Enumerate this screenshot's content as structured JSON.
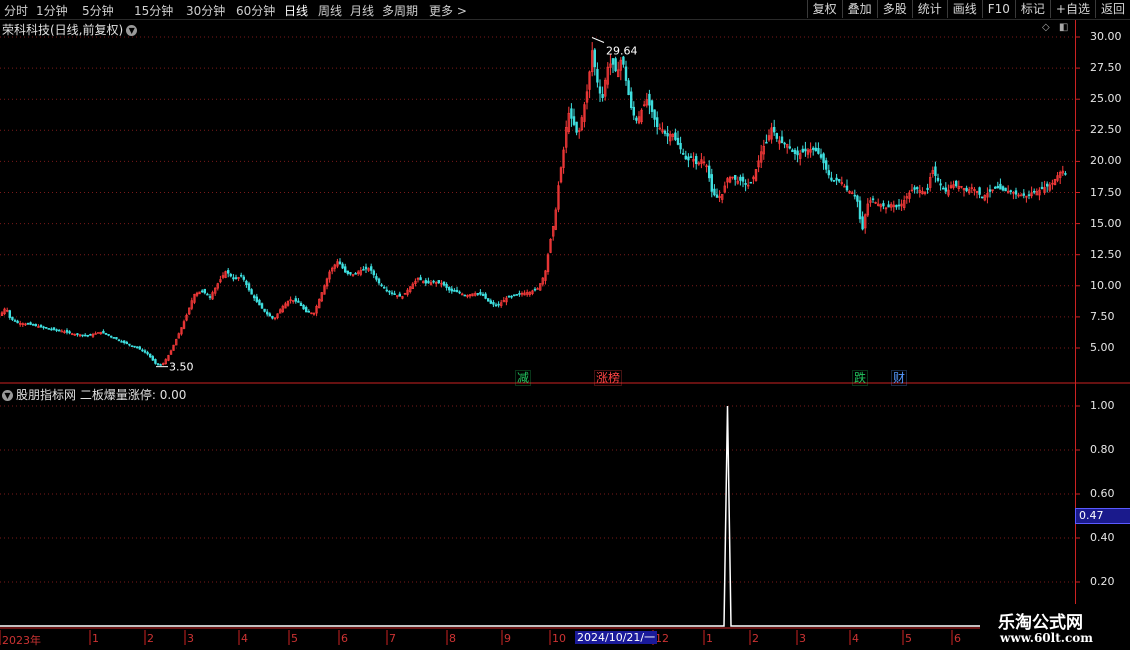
{
  "toolbar": {
    "periods": [
      "分时",
      "1分钟",
      "5分钟",
      "15分钟",
      "30分钟",
      "60分钟",
      "日线",
      "周线",
      "月线",
      "多周期",
      "更多 >"
    ],
    "active_period": "日线",
    "tools": [
      "复权",
      "叠加",
      "多股",
      "统计",
      "画线",
      "F10",
      "标记",
      "+自选",
      "返回"
    ]
  },
  "main_chart": {
    "title": "荣科科技(日线,前复权)",
    "high_label": "29.64",
    "low_label": "3.50",
    "y_ticks": [
      "30.00",
      "27.50",
      "25.00",
      "22.50",
      "20.00",
      "17.50",
      "15.00",
      "12.50",
      "10.00",
      "7.50",
      "5.00"
    ],
    "tags": [
      {
        "text": "减",
        "color": "#22c55e"
      },
      {
        "text": "涨榜",
        "color": "#ff4444"
      },
      {
        "text": "跌",
        "color": "#22c55e"
      },
      {
        "text": "财",
        "color": "#5599ff"
      }
    ]
  },
  "indicator": {
    "source": "股朋指标网",
    "name": "二板爆量涨停:",
    "value": "0.00",
    "y_ticks": [
      "1.00",
      "0.80",
      "0.60",
      "0.40",
      "0.20"
    ],
    "current_value": "0.47"
  },
  "x_axis": {
    "labels": [
      "2023年",
      "1",
      "2",
      "3",
      "4",
      "5",
      "6",
      "7",
      "8",
      "9",
      "10",
      "12",
      "1",
      "2",
      "3",
      "4",
      "5",
      "6"
    ],
    "selected_date": "2024/10/21/一"
  },
  "watermark": {
    "line1": "乐淘公式网",
    "line2": "www.60lt.com"
  },
  "chart_data": {
    "type": "candlestick",
    "title": "荣科科技(日线,前复权)",
    "ylim": [
      3,
      31
    ],
    "close_path": [
      [
        0,
        7.6
      ],
      [
        6,
        8.3
      ],
      [
        10,
        7.4
      ],
      [
        18,
        7.0
      ],
      [
        30,
        6.9
      ],
      [
        45,
        6.6
      ],
      [
        60,
        6.4
      ],
      [
        75,
        6.1
      ],
      [
        90,
        6.0
      ],
      [
        100,
        6.3
      ],
      [
        112,
        5.9
      ],
      [
        125,
        5.4
      ],
      [
        138,
        5.0
      ],
      [
        148,
        4.5
      ],
      [
        156,
        3.7
      ],
      [
        162,
        3.6
      ],
      [
        170,
        4.6
      ],
      [
        178,
        6.0
      ],
      [
        186,
        7.5
      ],
      [
        194,
        9.3
      ],
      [
        202,
        9.6
      ],
      [
        210,
        9.1
      ],
      [
        218,
        10.2
      ],
      [
        226,
        11.2
      ],
      [
        234,
        10.5
      ],
      [
        242,
        10.8
      ],
      [
        250,
        9.5
      ],
      [
        258,
        8.6
      ],
      [
        266,
        7.8
      ],
      [
        274,
        7.3
      ],
      [
        282,
        8.3
      ],
      [
        290,
        8.9
      ],
      [
        298,
        8.7
      ],
      [
        306,
        7.9
      ],
      [
        314,
        7.8
      ],
      [
        322,
        9.5
      ],
      [
        330,
        11.2
      ],
      [
        338,
        12.0
      ],
      [
        346,
        11.0
      ],
      [
        354,
        10.9
      ],
      [
        362,
        11.3
      ],
      [
        370,
        11.4
      ],
      [
        378,
        10.3
      ],
      [
        386,
        9.7
      ],
      [
        394,
        9.3
      ],
      [
        402,
        9.1
      ],
      [
        410,
        9.9
      ],
      [
        418,
        10.6
      ],
      [
        426,
        10.2
      ],
      [
        434,
        10.3
      ],
      [
        442,
        10.2
      ],
      [
        450,
        9.6
      ],
      [
        458,
        9.5
      ],
      [
        466,
        9.2
      ],
      [
        474,
        9.4
      ],
      [
        482,
        9.3
      ],
      [
        490,
        8.6
      ],
      [
        498,
        8.4
      ],
      [
        506,
        9.0
      ],
      [
        514,
        9.2
      ],
      [
        522,
        9.4
      ],
      [
        530,
        9.5
      ],
      [
        538,
        9.8
      ],
      [
        545,
        11.0
      ],
      [
        550,
        13.5
      ],
      [
        555,
        15.5
      ],
      [
        559,
        18.5
      ],
      [
        563,
        20.5
      ],
      [
        568,
        24.0
      ],
      [
        573,
        23.2
      ],
      [
        578,
        22.0
      ],
      [
        583,
        24.0
      ],
      [
        588,
        26.0
      ],
      [
        592,
        29.0
      ],
      [
        597,
        26.5
      ],
      [
        602,
        24.8
      ],
      [
        607,
        27.5
      ],
      [
        612,
        28.0
      ],
      [
        617,
        27.0
      ],
      [
        622,
        28.5
      ],
      [
        627,
        26.0
      ],
      [
        632,
        24.0
      ],
      [
        637,
        23.2
      ],
      [
        642,
        24.2
      ],
      [
        647,
        25.0
      ],
      [
        652,
        24.0
      ],
      [
        657,
        22.8
      ],
      [
        662,
        22.6
      ],
      [
        667,
        22.0
      ],
      [
        672,
        22.3
      ],
      [
        677,
        21.5
      ],
      [
        682,
        20.8
      ],
      [
        687,
        20.0
      ],
      [
        692,
        20.4
      ],
      [
        697,
        19.7
      ],
      [
        702,
        20.2
      ],
      [
        707,
        19.6
      ],
      [
        712,
        17.5
      ],
      [
        717,
        17.1
      ],
      [
        722,
        17.3
      ],
      [
        727,
        18.6
      ],
      [
        732,
        18.8
      ],
      [
        737,
        18.4
      ],
      [
        742,
        18.5
      ],
      [
        747,
        18.0
      ],
      [
        752,
        18.4
      ],
      [
        757,
        19.6
      ],
      [
        762,
        21.0
      ],
      [
        767,
        21.6
      ],
      [
        772,
        22.8
      ],
      [
        777,
        21.8
      ],
      [
        782,
        21.5
      ],
      [
        787,
        21.4
      ],
      [
        792,
        20.8
      ],
      [
        797,
        20.5
      ],
      [
        802,
        20.7
      ],
      [
        807,
        20.9
      ],
      [
        812,
        21.0
      ],
      [
        817,
        20.8
      ],
      [
        822,
        20.2
      ],
      [
        827,
        19.2
      ],
      [
        832,
        18.4
      ],
      [
        837,
        18.5
      ],
      [
        842,
        18.3
      ],
      [
        847,
        17.7
      ],
      [
        852,
        17.5
      ],
      [
        857,
        17.0
      ],
      [
        862,
        14.3
      ],
      [
        867,
        16.5
      ],
      [
        872,
        17.0
      ],
      [
        877,
        16.6
      ],
      [
        882,
        16.5
      ],
      [
        887,
        16.2
      ],
      [
        892,
        16.6
      ],
      [
        897,
        16.3
      ],
      [
        902,
        16.6
      ],
      [
        907,
        17.2
      ],
      [
        912,
        17.7
      ],
      [
        917,
        17.8
      ],
      [
        922,
        17.6
      ],
      [
        927,
        17.5
      ],
      [
        932,
        19.4
      ],
      [
        937,
        18.6
      ],
      [
        942,
        17.9
      ],
      [
        947,
        17.5
      ],
      [
        952,
        18.2
      ],
      [
        957,
        18.0
      ],
      [
        962,
        18.0
      ],
      [
        967,
        17.6
      ],
      [
        972,
        17.9
      ],
      [
        977,
        17.6
      ],
      [
        982,
        17.1
      ],
      [
        987,
        17.4
      ],
      [
        992,
        17.7
      ],
      [
        997,
        17.9
      ],
      [
        1002,
        17.7
      ],
      [
        1007,
        17.6
      ],
      [
        1012,
        17.6
      ],
      [
        1017,
        17.3
      ],
      [
        1022,
        17.3
      ],
      [
        1027,
        17.2
      ],
      [
        1032,
        17.5
      ],
      [
        1037,
        17.6
      ],
      [
        1042,
        17.8
      ],
      [
        1047,
        18.0
      ],
      [
        1052,
        18.2
      ],
      [
        1057,
        18.8
      ],
      [
        1062,
        19.3
      ],
      [
        1066,
        18.9
      ]
    ],
    "indicator_spike": {
      "x_position_label": "2024/10/21",
      "peak": 1.0,
      "baseline": 0.0
    }
  }
}
